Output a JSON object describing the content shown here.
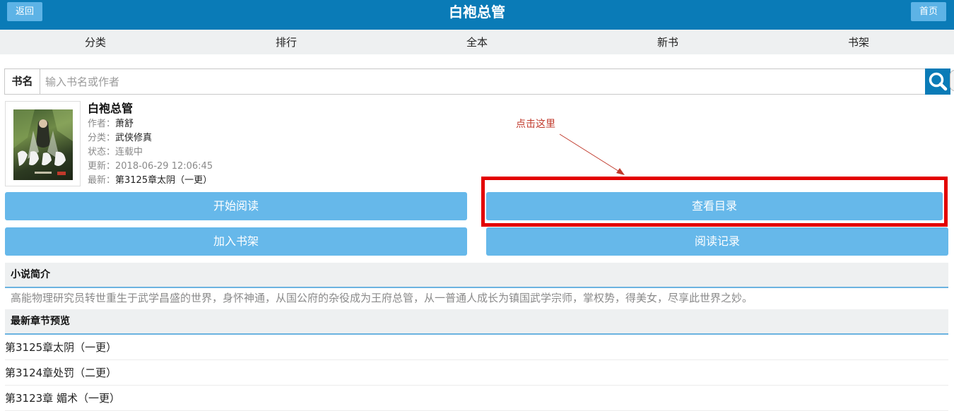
{
  "header": {
    "back_label": "返回",
    "title": "白袍总管",
    "home_label": "首页"
  },
  "nav": {
    "items": [
      "分类",
      "排行",
      "全本",
      "新书",
      "书架"
    ]
  },
  "search": {
    "label": "书名",
    "placeholder": "输入书名或作者",
    "button_icon": "search-icon"
  },
  "book": {
    "title": "白袍总管",
    "author_label": "作者：",
    "author": "萧舒",
    "category_label": "分类：",
    "category": "武侠修真",
    "status_label": "状态：",
    "status": "连载中",
    "updated_label": "更新：",
    "updated": "2018-06-29 12:06:45",
    "latest_label": "最新：",
    "latest": "第3125章太阴（一更）"
  },
  "annotation": {
    "text": "点击这里",
    "color": "#c0392b",
    "box_color": "#e30000"
  },
  "actions": {
    "start_reading": "开始阅读",
    "view_toc": "查看目录",
    "add_shelf": "加入书架",
    "reading_record": "阅读记录"
  },
  "intro": {
    "heading": "小说简介",
    "text": "高能物理研究员转世重生于武学昌盛的世界，身怀神通，从国公府的杂役成为王府总管，从一普通人成长为镇国武学宗师，掌权势，得美女，尽享此世界之妙。"
  },
  "latest_chapters": {
    "heading": "最新章节预览",
    "items": [
      "第3125章太阴（一更）",
      "第3124章处罚（二更）",
      "第3123章 媚术（一更）"
    ]
  },
  "colors": {
    "header_bg": "#0a7bb7",
    "button_bg": "#66b8ea",
    "nav_bg": "#eef0f1"
  }
}
